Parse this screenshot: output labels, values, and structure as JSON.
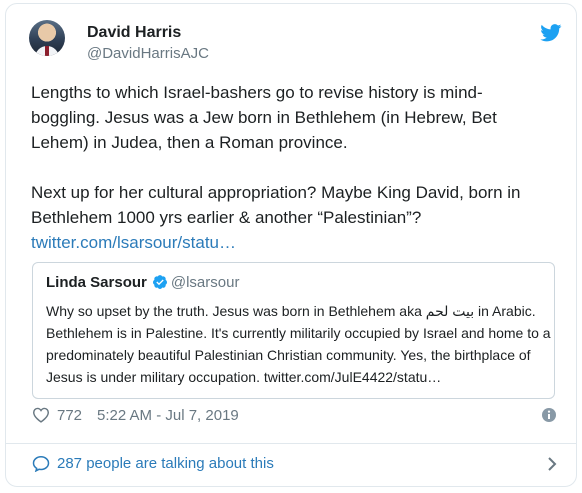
{
  "author": {
    "name": "David Harris",
    "handle": "@DavidHarrisAJC",
    "avatar_icon": "profile-photo"
  },
  "tweet": {
    "paragraph1": "Lengths to which Israel-bashers go to revise history is mind-boggling. Jesus was a Jew born in Bethlehem (in Hebrew, Bet Lehem) in Judea, then a Roman province.",
    "paragraph2_text": "Next up for her cultural appropriation? Maybe King David, born in Bethlehem 1000 yrs earlier & another “Palestinian”? ",
    "paragraph2_link": "twitter.com/lsarsour/statu…"
  },
  "quoted_tweet": {
    "name": "Linda Sarsour",
    "handle": "@lsarsour",
    "text": "Why so upset by the truth. Jesus was born in Bethlehem aka بيت لحم in Arabic. Bethlehem is in Palestine. It's currently militarily occupied by Israel and home to a predominately beautiful Palestinian Christian community. Yes, the birthplace of Jesus is under military occupation. twitter.com/JulE4422/statu…"
  },
  "meta": {
    "likes": "772",
    "timestamp": "5:22 AM - Jul 7, 2019"
  },
  "footer": {
    "talking": "287 people are talking about this"
  },
  "colors": {
    "brand": "#1da1f2",
    "link": "#2b7bb9",
    "muted": "#697882",
    "border": "#e1e8ed"
  }
}
